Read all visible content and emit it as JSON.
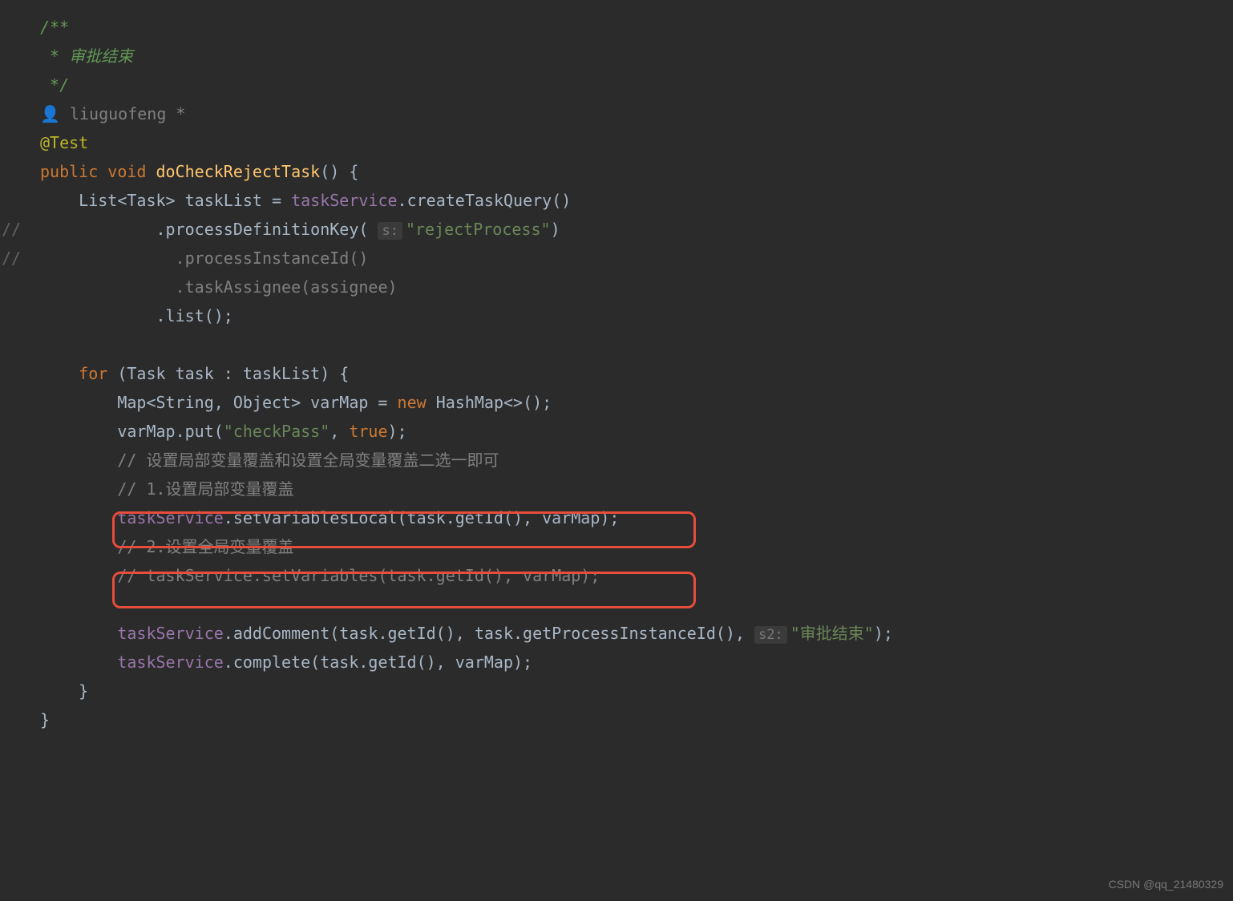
{
  "gutter": {
    "line8": "//",
    "line9": "//"
  },
  "code": {
    "line1": "/**",
    "line2_prefix": " * ",
    "line2_text": "审批结束",
    "line3": " */",
    "line4_author": "liuguofeng *",
    "line5": "@Test",
    "line6_public": "public",
    "line6_void": "void",
    "line6_method": "doCheckRejectTask",
    "line6_paren": "() {",
    "line7_type": "List<Task> taskList = ",
    "line7_field": "taskService",
    "line7_call": ".createTaskQuery()",
    "line8_call": ".processDefinitionKey( ",
    "line8_hint": "s:",
    "line8_str": "\"rejectProcess\"",
    "line8_end": ")",
    "line9_text": ".processInstanceId()",
    "line10_text": ".taskAssignee(assignee)",
    "line11_text": ".list();",
    "line13_for": "for",
    "line13_text": " (Task task : taskList) {",
    "line14_type": "Map<String, Object> varMap = ",
    "line14_new": "new",
    "line14_end": " HashMap<>();",
    "line15_pre": "varMap.put(",
    "line15_str": "\"checkPass\"",
    "line15_mid": ", ",
    "line15_true": "true",
    "line15_end": ");",
    "line16": "// 设置局部变量覆盖和设置全局变量覆盖二选一即可",
    "line17": "// 1.设置局部变量覆盖",
    "line18_field": "taskService",
    "line18_text": ".setVariablesLocal(task.getId(), varMap);",
    "line19": "// 2.设置全局变量覆盖",
    "line20": "// taskService.setVariables(task.getId(), varMap);",
    "line22_field": "taskService",
    "line22_text1": ".addComment(task.getId(), task.getProcessInstanceId(), ",
    "line22_hint": "s2:",
    "line22_str": "\"审批结束\"",
    "line22_end": ");",
    "line23_field": "taskService",
    "line23_text": ".complete(task.getId(), varMap);",
    "line24": "}",
    "line25": "}"
  },
  "watermark": "CSDN @qq_21480329"
}
